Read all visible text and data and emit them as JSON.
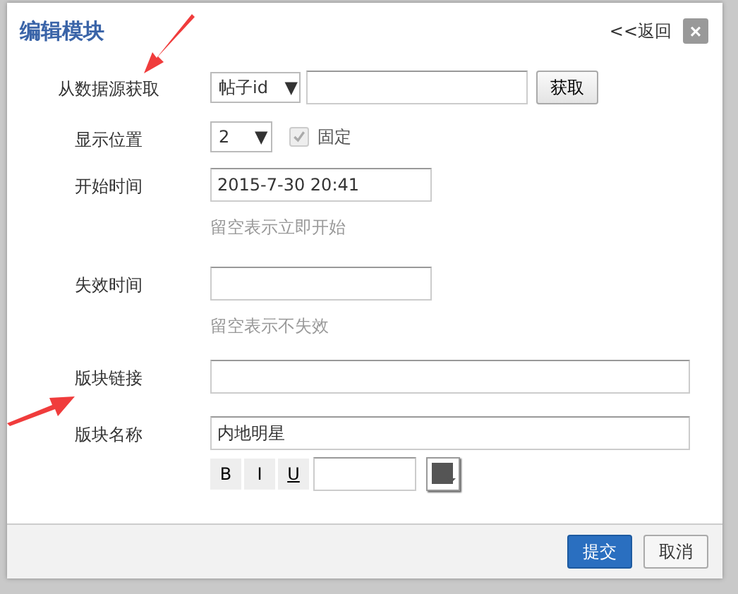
{
  "dialog": {
    "title": "编辑模块",
    "back_link": "<<返回",
    "close": "×"
  },
  "form": {
    "source": {
      "label": "从数据源获取",
      "select": "帖子id ▼",
      "button": "获取"
    },
    "position": {
      "label": "显示位置",
      "select": "2 ▼",
      "fixed": {
        "label": "固定",
        "checked": true,
        "disabled": true
      }
    },
    "start_time": {
      "label": "开始时间",
      "value": "2015-7-30 20:41",
      "hint": "留空表示立即开始"
    },
    "end_time": {
      "label": "失效时间",
      "hint": "留空表示不失效"
    },
    "link": {
      "label": "版块链接"
    },
    "name": {
      "label": "版块名称",
      "value": "内地明星",
      "format_buttons": [
        "B",
        "I",
        "U"
      ]
    }
  },
  "footer": {
    "buttons": [
      {
        "label": "提交",
        "kind": "primary"
      },
      {
        "label": "取消",
        "kind": "secondary"
      }
    ]
  }
}
